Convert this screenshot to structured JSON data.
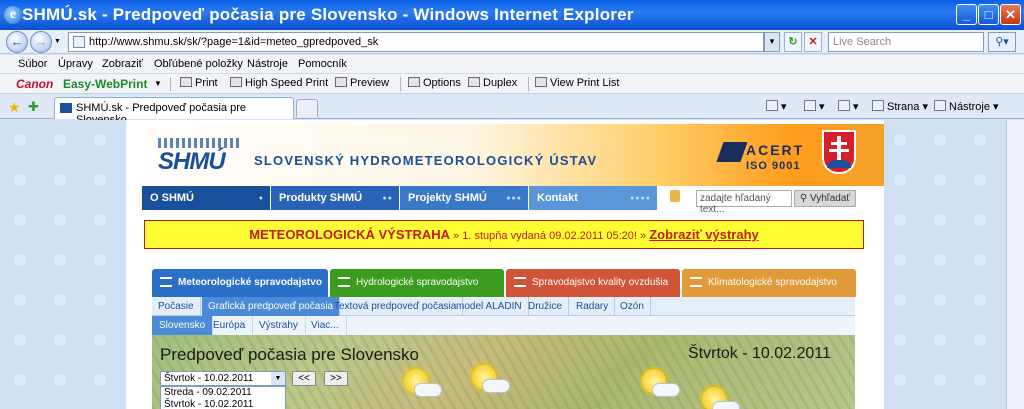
{
  "window": {
    "title": "SHMÚ.sk - Predpoveď počasia pre Slovensko - Windows Internet Explorer",
    "minimize": "_",
    "maximize": "□",
    "close": "✕"
  },
  "address": {
    "url": "http://www.shmu.sk/sk/?page=1&id=meteo_gpredpoved_sk",
    "search_placeholder": "Live Search"
  },
  "menu": [
    "Súbor",
    "Úpravy",
    "Zobraziť",
    "Obľúbené položky",
    "Nástroje",
    "Pomocník"
  ],
  "canon_toolbar": {
    "brand": "Canon",
    "product": "Easy-WebPrint",
    "buttons": [
      "Print",
      "High Speed Print",
      "Preview",
      "Options",
      "Duplex",
      "View Print List"
    ]
  },
  "tabs": {
    "active_tab": "SHMÚ.sk - Predpoveď počasia pre Slovensko",
    "commands": [
      "Strana",
      "Nástroje"
    ]
  },
  "site": {
    "logo": "SHMÚ",
    "title": "SLOVENSKÝ HYDROMETEOROLOGICKÝ ÚSTAV",
    "cert_name": "ACERT",
    "cert_iso": "ISO 9001",
    "nav": [
      {
        "label": "O SHMÚ",
        "color": "#1a4f9c"
      },
      {
        "label": "Produkty SHMÚ",
        "color": "#2a62b8"
      },
      {
        "label": "Projekty SHMÚ",
        "color": "#3a78c8"
      },
      {
        "label": "Kontakt",
        "color": "#5a96d8"
      }
    ],
    "search_placeholder": "zadajte hľadaný text...",
    "search_button": "Vyhľadať",
    "warning": {
      "main": "METEOROLOGICKÁ VÝSTRAHA",
      "detail": "» 1. stupňa vydaná 09.02.2011 05:20! »",
      "link": "Zobraziť výstrahy"
    },
    "categories": [
      {
        "label": "Meteorologické spravodajstvo",
        "color": "#2a6fc8"
      },
      {
        "label": "Hydrologické spravodajstvo",
        "color": "#3c9c1e"
      },
      {
        "label": "Spravodajstvo kvality ovzdušia",
        "color": "#d0543a"
      },
      {
        "label": "Klimatologické spravodajstvo",
        "color": "#e09a3a"
      }
    ],
    "subnav": [
      "Počasie",
      "Grafická predpoveď počasia",
      "Textová predpoveď počasia",
      "model ALADIN",
      "Družice",
      "Radary",
      "Ozón"
    ],
    "subnav2": [
      "Slovensko",
      "Európa",
      "Výstrahy",
      "Viac..."
    ],
    "map": {
      "title": "Predpoveď počasia pre Slovensko",
      "date": "Štvrtok - 10.02.2011",
      "selected_day": "Štvrtok - 10.02.2011",
      "day_options": [
        "Streda - 09.02.2011",
        "Štvrtok - 10.02.2011"
      ],
      "prev": "<<",
      "next": ">>"
    }
  }
}
